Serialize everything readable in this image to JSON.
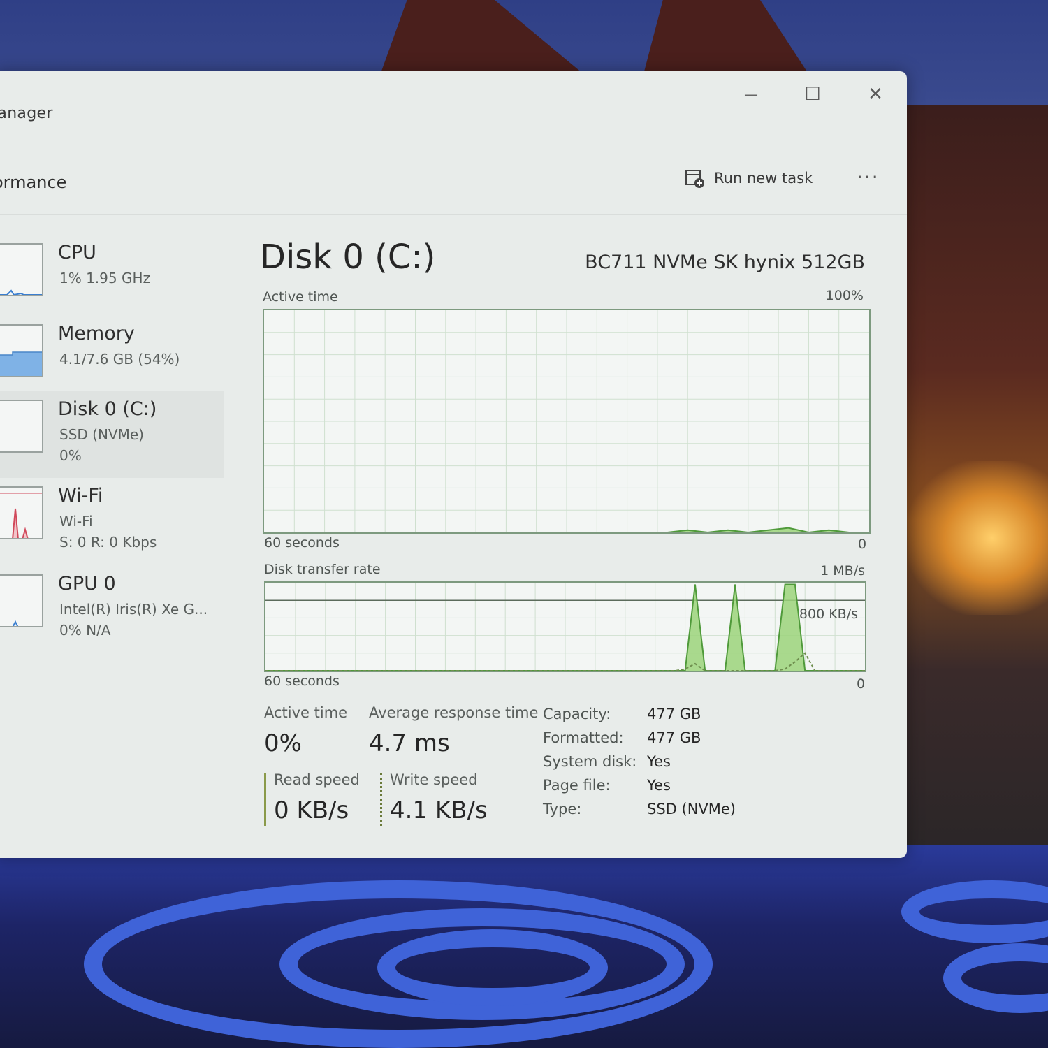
{
  "window": {
    "app_title": "lanager",
    "section_title": "ormance",
    "run_new_task_label": "Run new task",
    "more_label": "···",
    "controls": {
      "minimize": "—",
      "maximize": "☐",
      "close": "✕"
    }
  },
  "sidebar": {
    "items": [
      {
        "name": "CPU",
        "line1": "1%  1.95 GHz",
        "line2": "",
        "line3": ""
      },
      {
        "name": "Memory",
        "line1": "4.1/7.6 GB (54%)",
        "line2": "",
        "line3": ""
      },
      {
        "name": "Disk 0 (C:)",
        "line1": "SSD (NVMe)",
        "line2": "0%",
        "line3": ""
      },
      {
        "name": "Wi-Fi",
        "line1": "Wi-Fi",
        "line2": "S: 0 R: 0 Kbps",
        "line3": ""
      },
      {
        "name": "GPU 0",
        "line1": "Intel(R) Iris(R) Xe G...",
        "line2": "0%  N/A",
        "line3": ""
      }
    ]
  },
  "main": {
    "title": "Disk 0 (C:)",
    "model": "BC711 NVMe SK hynix 512GB",
    "active_chart": {
      "label": "Active time",
      "max_label": "100%",
      "x_left_label": "60 seconds",
      "x_right_label": "0"
    },
    "transfer_chart": {
      "label": "Disk transfer rate",
      "max_label": "1 MB/s",
      "line_label": "800 KB/s",
      "x_left_label": "60 seconds",
      "x_right_label": "0"
    },
    "stats": {
      "active_time_label": "Active time",
      "active_time_value": "0%",
      "avg_response_label": "Average response time",
      "avg_response_value": "4.7 ms",
      "read_speed_label": "Read speed",
      "read_speed_value": "0 KB/s",
      "write_speed_label": "Write speed",
      "write_speed_value": "4.1 KB/s"
    },
    "properties": [
      {
        "label": "Capacity:",
        "value": "477 GB"
      },
      {
        "label": "Formatted:",
        "value": "477 GB"
      },
      {
        "label": "System disk:",
        "value": "Yes"
      },
      {
        "label": "Page file:",
        "value": "Yes"
      },
      {
        "label": "Type:",
        "value": "SSD (NVMe)"
      }
    ]
  },
  "colors": {
    "disk_green": "#9bd37a",
    "disk_green_dark": "#4f9a3a",
    "memory_blue": "#7fb2e6",
    "wifi_red": "#d0485a",
    "cpu_blue": "#3b7fd0"
  },
  "chart_data": [
    {
      "type": "area",
      "title": "Active time",
      "xlabel": "60 seconds",
      "xlim": [
        60,
        0
      ],
      "ylim": [
        0,
        100
      ],
      "x": [
        60,
        20,
        18,
        16,
        14,
        12,
        10,
        8,
        6,
        4,
        2,
        0
      ],
      "values": [
        0,
        0,
        1,
        0,
        1,
        0,
        1,
        2,
        0,
        1,
        0,
        0
      ]
    },
    {
      "type": "area",
      "title": "Disk transfer rate",
      "xlabel": "60 seconds",
      "xlim": [
        60,
        0
      ],
      "ylim": [
        0,
        1000
      ],
      "series": [
        {
          "name": "Read speed",
          "x": [
            60,
            20,
            19,
            18,
            17,
            16,
            15,
            14,
            13,
            12,
            11,
            10,
            9,
            8,
            7,
            6,
            5,
            0
          ],
          "values": [
            0,
            0,
            0,
            20,
            80,
            0,
            0,
            0,
            0,
            0,
            0,
            0,
            0,
            20,
            100,
            200,
            0,
            0
          ]
        },
        {
          "name": "Write speed",
          "x": [
            60,
            18,
            17,
            16,
            15,
            14,
            13,
            12,
            11,
            10,
            9,
            8,
            7,
            6,
            5,
            0
          ],
          "values": [
            0,
            0,
            980,
            0,
            0,
            0,
            980,
            0,
            0,
            0,
            0,
            980,
            980,
            0,
            0,
            0
          ]
        }
      ]
    }
  ]
}
